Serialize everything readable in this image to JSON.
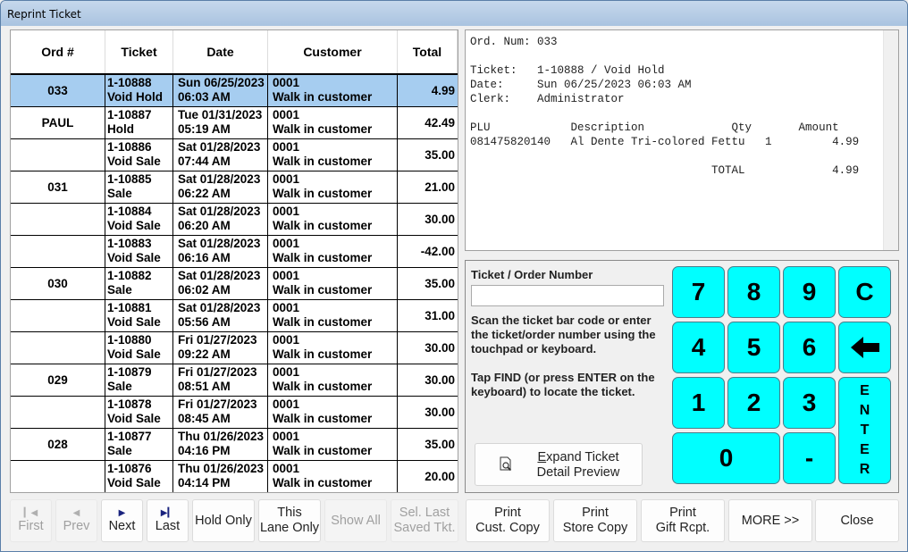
{
  "window": {
    "title": "Reprint Ticket"
  },
  "grid": {
    "columns": [
      "Ord #",
      "Ticket",
      "Date",
      "Customer",
      "Total"
    ],
    "rows": [
      {
        "ord": "033",
        "ticket": "1-10888",
        "type": "Void Hold",
        "date": "Sun 06/25/2023",
        "time": "06:03 AM",
        "cust_id": "0001",
        "cust_name": "Walk in customer",
        "total": "4.99",
        "selected": true
      },
      {
        "ord": "PAUL",
        "ticket": "1-10887",
        "type": "Hold",
        "date": "Tue 01/31/2023",
        "time": "05:19 AM",
        "cust_id": "0001",
        "cust_name": "Walk in customer",
        "total": "42.49"
      },
      {
        "ord": "",
        "ticket": "1-10886",
        "type": "Void Sale",
        "date": "Sat 01/28/2023",
        "time": "07:44 AM",
        "cust_id": "0001",
        "cust_name": "Walk in customer",
        "total": "35.00"
      },
      {
        "ord": "031",
        "ticket": "1-10885",
        "type": "Sale",
        "date": "Sat 01/28/2023",
        "time": "06:22 AM",
        "cust_id": "0001",
        "cust_name": "Walk in customer",
        "total": "21.00"
      },
      {
        "ord": "",
        "ticket": "1-10884",
        "type": "Void Sale",
        "date": "Sat 01/28/2023",
        "time": "06:20 AM",
        "cust_id": "0001",
        "cust_name": "Walk in customer",
        "total": "30.00"
      },
      {
        "ord": "",
        "ticket": "1-10883",
        "type": "Void Sale",
        "date": "Sat 01/28/2023",
        "time": "06:16 AM",
        "cust_id": "0001",
        "cust_name": "Walk in customer",
        "total": "-42.00"
      },
      {
        "ord": "030",
        "ticket": "1-10882",
        "type": "Sale",
        "date": "Sat 01/28/2023",
        "time": "06:02 AM",
        "cust_id": "0001",
        "cust_name": "Walk in customer",
        "total": "35.00"
      },
      {
        "ord": "",
        "ticket": "1-10881",
        "type": "Void Sale",
        "date": "Sat 01/28/2023",
        "time": "05:56 AM",
        "cust_id": "0001",
        "cust_name": "Walk in customer",
        "total": "31.00"
      },
      {
        "ord": "",
        "ticket": "1-10880",
        "type": "Void Sale",
        "date": "Fri 01/27/2023",
        "time": "09:22 AM",
        "cust_id": "0001",
        "cust_name": "Walk in customer",
        "total": "30.00"
      },
      {
        "ord": "029",
        "ticket": "1-10879",
        "type": "Sale",
        "date": "Fri 01/27/2023",
        "time": "08:51 AM",
        "cust_id": "0001",
        "cust_name": "Walk in customer",
        "total": "30.00"
      },
      {
        "ord": "",
        "ticket": "1-10878",
        "type": "Void Sale",
        "date": "Fri 01/27/2023",
        "time": "08:45 AM",
        "cust_id": "0001",
        "cust_name": "Walk in customer",
        "total": "30.00"
      },
      {
        "ord": "028",
        "ticket": "1-10877",
        "type": "Sale",
        "date": "Thu 01/26/2023",
        "time": "04:16 PM",
        "cust_id": "0001",
        "cust_name": "Walk in customer",
        "total": "35.00"
      },
      {
        "ord": "",
        "ticket": "1-10876",
        "type": "Void Sale",
        "date": "Thu 01/26/2023",
        "time": "04:14 PM",
        "cust_id": "0001",
        "cust_name": "Walk in customer",
        "total": "20.00"
      }
    ]
  },
  "preview": {
    "lines": [
      "Ord. Num: 033",
      "",
      "Ticket:   1-10888 / Void Hold",
      "Date:     Sun 06/25/2023 06:03 AM",
      "Clerk:    Administrator",
      "",
      "PLU            Description             Qty       Amount",
      "081475820140   Al Dente Tri-colored Fettu   1         4.99",
      "",
      "                                    TOTAL             4.99"
    ]
  },
  "entry": {
    "label": "Ticket / Order Number",
    "value": "",
    "help1": "Scan the ticket bar code or enter the ticket/order number using the touchpad or keyboard.",
    "help2": "Tap FIND (or press ENTER on the keyboard) to locate the ticket.",
    "expand_line1_first": "E",
    "expand_line1_rest": "xpand Ticket",
    "expand_line2": "Detail Preview"
  },
  "keypad": {
    "k7": "7",
    "k8": "8",
    "k9": "9",
    "clear": "C",
    "k4": "4",
    "k5": "5",
    "k6": "6",
    "k1": "1",
    "k2": "2",
    "k3": "3",
    "k0": "0",
    "dash": "-",
    "enter": [
      "E",
      "N",
      "T",
      "E",
      "R"
    ],
    "color": "#00ffff"
  },
  "nav_buttons": {
    "first": "First",
    "prev": "Prev",
    "next": "Next",
    "last": "Last",
    "hold_only": "Hold Only",
    "this_lane_1": "This",
    "this_lane_2": "Lane Only",
    "show_all": "Show All",
    "sel_last_1": "Sel. Last",
    "sel_last_2": "Saved Tkt."
  },
  "action_buttons": {
    "print_cust_1": "Print",
    "print_cust_2": "Cust. Copy",
    "print_store_1": "Print",
    "print_store_2": "Store Copy",
    "print_gift_1": "Print",
    "print_gift_2": "Gift Rcpt.",
    "more": "MORE >>",
    "close": "Close"
  },
  "colors": {
    "selected_row": "#a6cdf0",
    "keypad": "#00ffff"
  }
}
